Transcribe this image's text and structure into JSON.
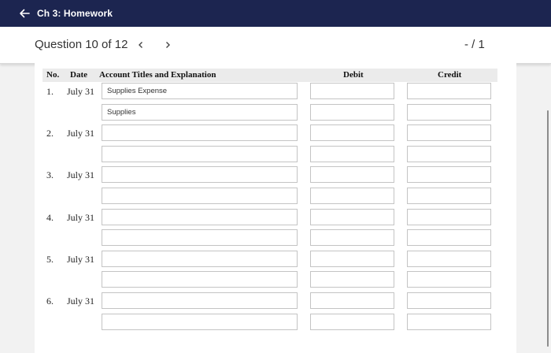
{
  "header": {
    "title": "Ch 3: Homework"
  },
  "question_bar": {
    "label": "Question 10 of 12",
    "prev_icon": "chevron-left-icon",
    "next_icon": "chevron-right-icon",
    "score": "- / 1",
    "list_icon": "question-list-icon"
  },
  "table": {
    "columns": {
      "no": "No.",
      "date": "Date",
      "account": "Account Titles and Explanation",
      "debit": "Debit",
      "credit": "Credit"
    },
    "entries": [
      {
        "no": "1.",
        "date": "July 31",
        "lines": [
          {
            "account": "Supplies Expense",
            "debit": "",
            "credit": ""
          },
          {
            "account": "Supplies",
            "debit": "",
            "credit": ""
          }
        ]
      },
      {
        "no": "2.",
        "date": "July 31",
        "lines": [
          {
            "account": "",
            "debit": "",
            "credit": ""
          },
          {
            "account": "",
            "debit": "",
            "credit": ""
          }
        ]
      },
      {
        "no": "3.",
        "date": "July 31",
        "lines": [
          {
            "account": "",
            "debit": "",
            "credit": ""
          },
          {
            "account": "",
            "debit": "",
            "credit": ""
          }
        ]
      },
      {
        "no": "4.",
        "date": "July 31",
        "lines": [
          {
            "account": "",
            "debit": "",
            "credit": ""
          },
          {
            "account": "",
            "debit": "",
            "credit": ""
          }
        ]
      },
      {
        "no": "5.",
        "date": "July 31",
        "lines": [
          {
            "account": "",
            "debit": "",
            "credit": ""
          },
          {
            "account": "",
            "debit": "",
            "credit": ""
          }
        ]
      },
      {
        "no": "6.",
        "date": "July 31",
        "lines": [
          {
            "account": "",
            "debit": "",
            "credit": ""
          },
          {
            "account": "",
            "debit": "",
            "credit": ""
          }
        ]
      }
    ]
  },
  "colors": {
    "header_bg": "#1c2550",
    "table_header_bg": "#ebebeb"
  }
}
